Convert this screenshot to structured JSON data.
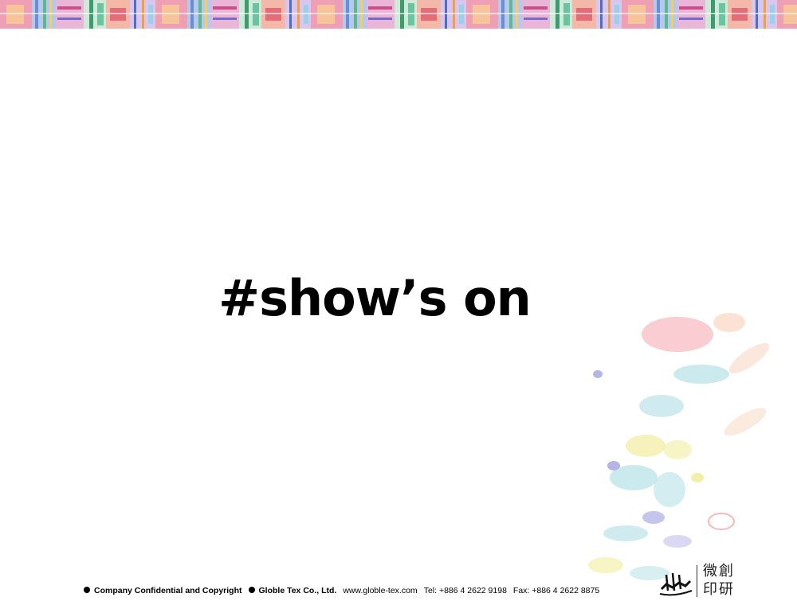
{
  "slide": {
    "title": "#show’s on"
  },
  "footer": {
    "confidential": "Company Confidential and Copyright",
    "company": "Globle Tex Co., Ltd.",
    "website": "www.globle-tex.com",
    "tel": "Tel: +886 4 2622 9198",
    "fax": "Fax: +886 4 2622 8875"
  },
  "logo": {
    "line1": "微創",
    "line2": "印研"
  },
  "colors": {
    "banner_pink": "#e8a0b8",
    "banner_green": "#5fb88a",
    "banner_blue": "#6a8fd0",
    "banner_yellow": "#f0d060",
    "splash_teal": "#8cd0d8",
    "splash_pink": "#f2a0a8",
    "splash_yellow": "#f0ea90",
    "splash_violet": "#9c9ce0"
  }
}
